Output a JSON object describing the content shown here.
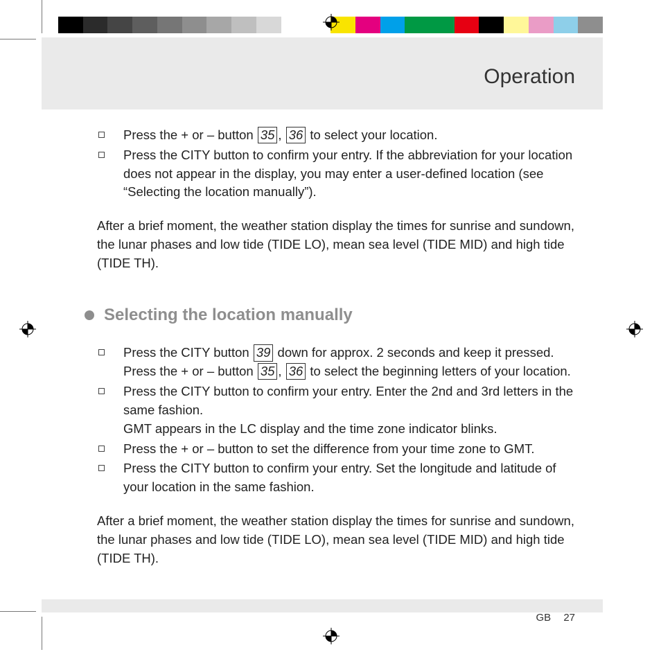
{
  "header": {
    "title": "Operation"
  },
  "list1": {
    "i1_a": "Press the + or – button ",
    "i1_ref1": "35",
    "i1_sep": ", ",
    "i1_ref2": "36",
    "i1_b": " to select your location.",
    "i2": "Press the CITY button to confirm your entry. If the abbreviation for your location does not appear in the display, you may enter a user-defined location (see “Selecting the location manually”)."
  },
  "para1": "After a brief moment, the weather station display the times for sunrise and sundown, the lunar phases and low tide (TIDE LO), mean sea level (TIDE MID) and high tide (TIDE TH).",
  "section": {
    "title": "Selecting the location manually"
  },
  "list2": {
    "i1_a": "Press the CITY button ",
    "i1_ref1": "39",
    "i1_b": " down for approx. 2 seconds and keep it pressed.",
    "i1_line2_a": "Press the + or – button ",
    "i1_ref2": "35",
    "i1_sep": ", ",
    "i1_ref3": "36",
    "i1_line2_b": " to select the beginning letters of your location.",
    "i2_a": "Press the CITY button to confirm your entry. Enter the 2nd and 3rd letters in the same fashion.",
    "i2_b": "GMT appears in the LC display and the time zone indicator blinks.",
    "i3": "Press the + or – button to set the difference from your time zone to GMT.",
    "i4": "Press the CITY button to confirm your entry. Set the longitude and latitude of your location in the same fashion."
  },
  "para2": "After a brief moment, the weather station display the times for sunrise and sundown, the lunar phases and low tide (TIDE LO), mean sea level (TIDE MID) and high tide (TIDE TH).",
  "footer": {
    "lang": "GB",
    "page": "27"
  },
  "colorbar": [
    "#000000",
    "#2b2b2b",
    "#454545",
    "#5e5e5e",
    "#767676",
    "#8e8e8e",
    "#a7a7a7",
    "#bfbfbf",
    "#d8d8d8",
    "#ffffff",
    "#ffffff",
    "#f9e400",
    "#e4007f",
    "#00a0e9",
    "#009944",
    "#009944",
    "#e60012",
    "#000000",
    "#fff799",
    "#ea9cc6",
    "#8ecfe9",
    "#8e8e8e"
  ]
}
